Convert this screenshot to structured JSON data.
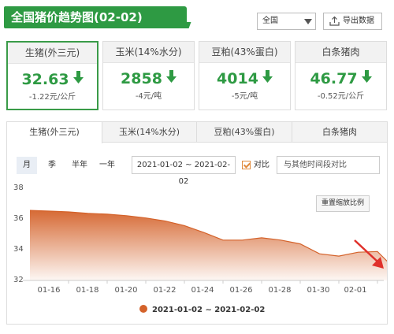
{
  "title": "全国猪价趋势图(02-02)",
  "region_select": {
    "value": "全国",
    "icon": "chevron-down-icon"
  },
  "export_button": {
    "label": "导出数据",
    "icon": "upload-icon"
  },
  "colors": {
    "brand_green": "#2e9a43",
    "series_orange": "#d4622a",
    "down_arrow": "#2e9a43"
  },
  "cards": [
    {
      "name": "生猪(外三元)",
      "value": "32.63",
      "change": "-1.22元/公斤",
      "trend": "down",
      "active": true
    },
    {
      "name": "玉米(14%水分)",
      "value": "2858",
      "change": "-4元/吨",
      "trend": "down",
      "active": false
    },
    {
      "name": "豆粕(43%蛋白)",
      "value": "4014",
      "change": "-5元/吨",
      "trend": "down",
      "active": false
    },
    {
      "name": "白条猪肉",
      "value": "46.77",
      "change": "-0.52元/公斤",
      "trend": "down",
      "active": false
    }
  ],
  "tabs": [
    "生猪(外三元)",
    "玉米(14%水分)",
    "豆粕(43%蛋白)",
    "白条猪肉"
  ],
  "active_tab": 0,
  "periods": [
    "月",
    "季",
    "半年",
    "一年"
  ],
  "active_period": 0,
  "date_range": "2021-01-02 ~ 2021-02-02",
  "compare": {
    "label": "对比",
    "checked": true,
    "placeholder": "与其他时间段对比"
  },
  "zoom_button": "重置缩放比例",
  "chart_data": {
    "type": "area",
    "title": "",
    "xlabel": "",
    "ylabel": "",
    "ylim": [
      32,
      38
    ],
    "yticks": [
      "38",
      "36",
      "34",
      "32"
    ],
    "xticks": [
      "01-16",
      "01-18",
      "01-20",
      "01-22",
      "01-24",
      "01-26",
      "01-28",
      "01-30",
      "02-01"
    ],
    "grid": false,
    "legend_position": "bottom",
    "series": [
      {
        "name": "2021-01-02 ~ 2021-02-02",
        "color": "#d4622a",
        "x": [
          "01-14",
          "01-15",
          "01-16",
          "01-17",
          "01-18",
          "01-19",
          "01-20",
          "01-21",
          "01-22",
          "01-23",
          "01-24",
          "01-25",
          "01-26",
          "01-27",
          "01-28",
          "01-29",
          "01-30",
          "01-31",
          "02-01",
          "02-02"
        ],
        "values": [
          36.6,
          36.55,
          36.5,
          36.4,
          36.35,
          36.25,
          36.1,
          35.9,
          35.6,
          35.15,
          34.65,
          34.65,
          34.8,
          34.65,
          34.4,
          33.75,
          33.6,
          33.85,
          33.9,
          32.63
        ]
      }
    ]
  }
}
